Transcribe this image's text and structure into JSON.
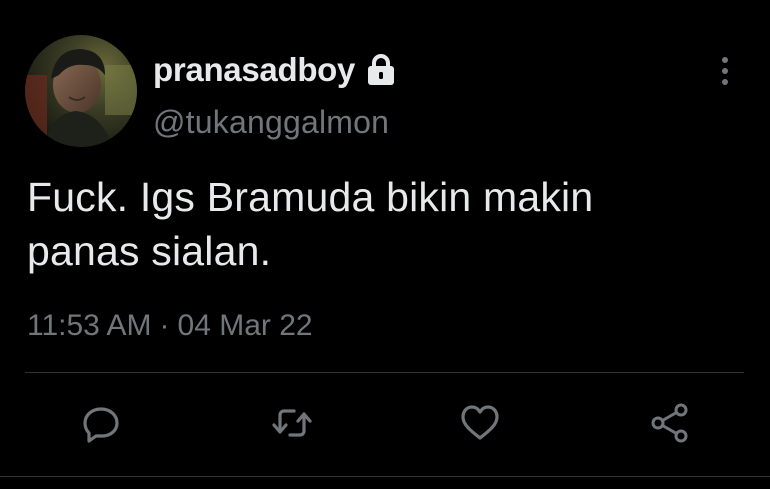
{
  "user": {
    "display_name": "pranasadboy",
    "handle": "@tukanggalmon",
    "protected": true,
    "avatar_icon": "profile-photo"
  },
  "tweet": {
    "text_line1": "Fuck. Igs Bramuda bikin makin",
    "text_line2": "panas sialan.",
    "time": "11:53 AM",
    "separator": "·",
    "date": "04 Mar 22"
  },
  "icons": {
    "lock": "lock-icon",
    "more": "more-vertical-icon",
    "reply": "reply-icon",
    "retweet": "retweet-icon",
    "like": "heart-icon",
    "share": "share-icon"
  },
  "colors": {
    "background": "#000000",
    "primary_text": "#e7e9ea",
    "secondary_text": "#71767b",
    "divider": "#2f3336"
  }
}
